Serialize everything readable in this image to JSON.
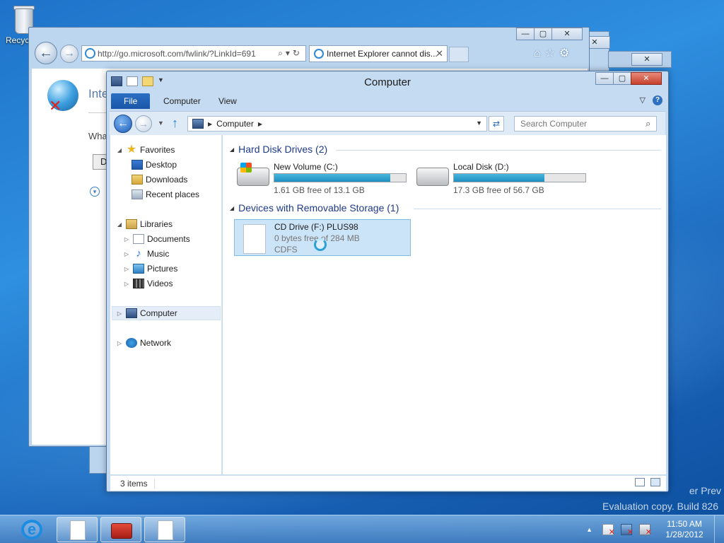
{
  "desktop": {
    "recycle_bin_label": "Recyc",
    "watermark_line1": "er Prev",
    "watermark_line2": "Evaluation copy. Build 826"
  },
  "ie_window": {
    "address": "http://go.microsoft.com/fwlink/?LinkId=691",
    "tab_title": "Internet Explorer cannot dis...",
    "page_heading": "Inte",
    "page_question": "Wha",
    "diag_button": "D"
  },
  "explorer": {
    "title": "Computer",
    "ribbon_tabs": [
      "File",
      "Computer",
      "View"
    ],
    "breadcrumb": [
      "Computer"
    ],
    "search_placeholder": "Search Computer",
    "nav": {
      "favorites": "Favorites",
      "desktop": "Desktop",
      "downloads": "Downloads",
      "recent_places": "Recent places",
      "libraries": "Libraries",
      "documents": "Documents",
      "music": "Music",
      "pictures": "Pictures",
      "videos": "Videos",
      "computer": "Computer",
      "network": "Network"
    },
    "groups": {
      "hard_disks": "Hard Disk Drives (2)",
      "removable": "Devices with Removable Storage (1)"
    },
    "drives": [
      {
        "name": "New Volume (C:)",
        "free_text": "1.61 GB free of 13.1 GB",
        "used_fraction": 0.88
      },
      {
        "name": "Local Disk (D:)",
        "free_text": "17.3 GB free of 56.7 GB",
        "used_fraction": 0.69
      }
    ],
    "cd_drive": {
      "name": "CD Drive (F:) PLUS98",
      "free_text": "0 bytes free of 284 MB",
      "filesystem": "CDFS"
    },
    "status": "3 items"
  },
  "taskbar": {
    "time": "11:50 AM",
    "date": "1/28/2012"
  },
  "colors": {
    "accent": "#1a56a8",
    "drive_fill": "#1f8fc0",
    "selection": "#cce4f7"
  }
}
